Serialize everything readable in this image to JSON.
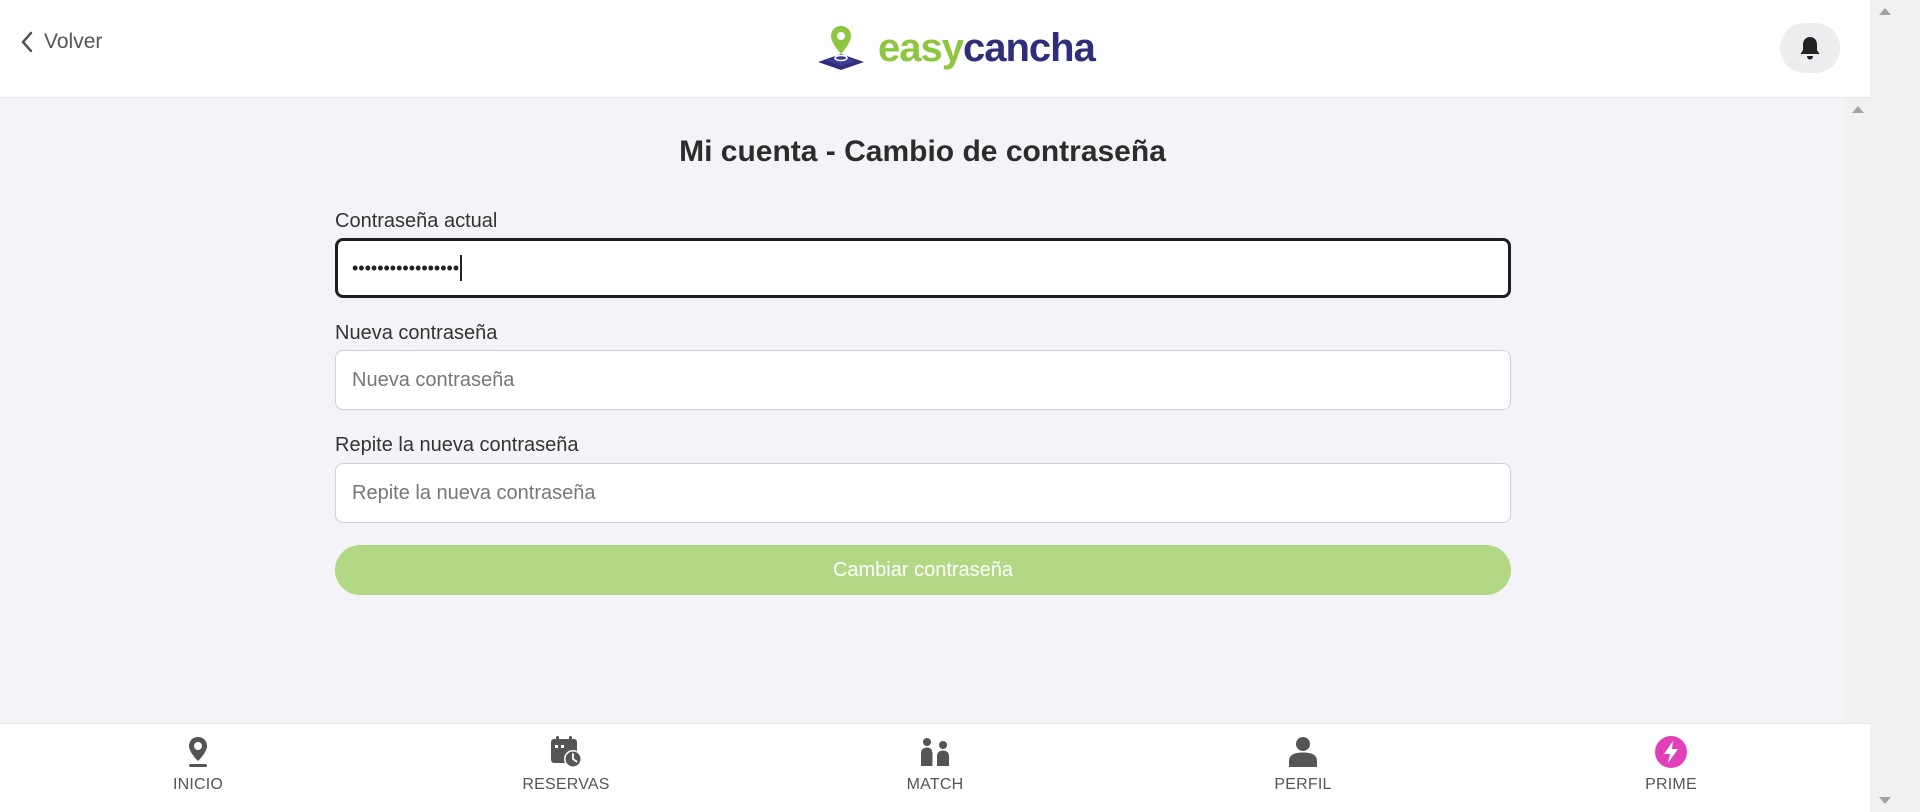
{
  "header": {
    "back_label": "Volver",
    "logo": {
      "easy": "easy",
      "cancha": "cancha"
    }
  },
  "page": {
    "title": "Mi cuenta - Cambio de contraseña"
  },
  "form": {
    "current": {
      "label": "Contraseña actual",
      "value": "•••••••••••••••••"
    },
    "new": {
      "label": "Nueva contraseña",
      "placeholder": "Nueva contraseña"
    },
    "repeat": {
      "label": "Repite la nueva contraseña",
      "placeholder": "Repite la nueva contraseña"
    },
    "submit_label": "Cambiar contraseña"
  },
  "nav": {
    "items": [
      {
        "label": "INICIO",
        "icon": "location-pin-icon"
      },
      {
        "label": "RESERVAS",
        "icon": "calendar-clock-icon"
      },
      {
        "label": "MATCH",
        "icon": "players-versus-icon"
      },
      {
        "label": "PERFIL",
        "icon": "user-icon"
      },
      {
        "label": "PRIME",
        "icon": "lightning-badge-icon"
      }
    ]
  },
  "colors": {
    "brand_green": "#8dc63f",
    "brand_navy": "#2e2e7a",
    "button_disabled": "#b3d885",
    "prime_pink": "#e040b8",
    "page_background": "#f4f4f8"
  }
}
